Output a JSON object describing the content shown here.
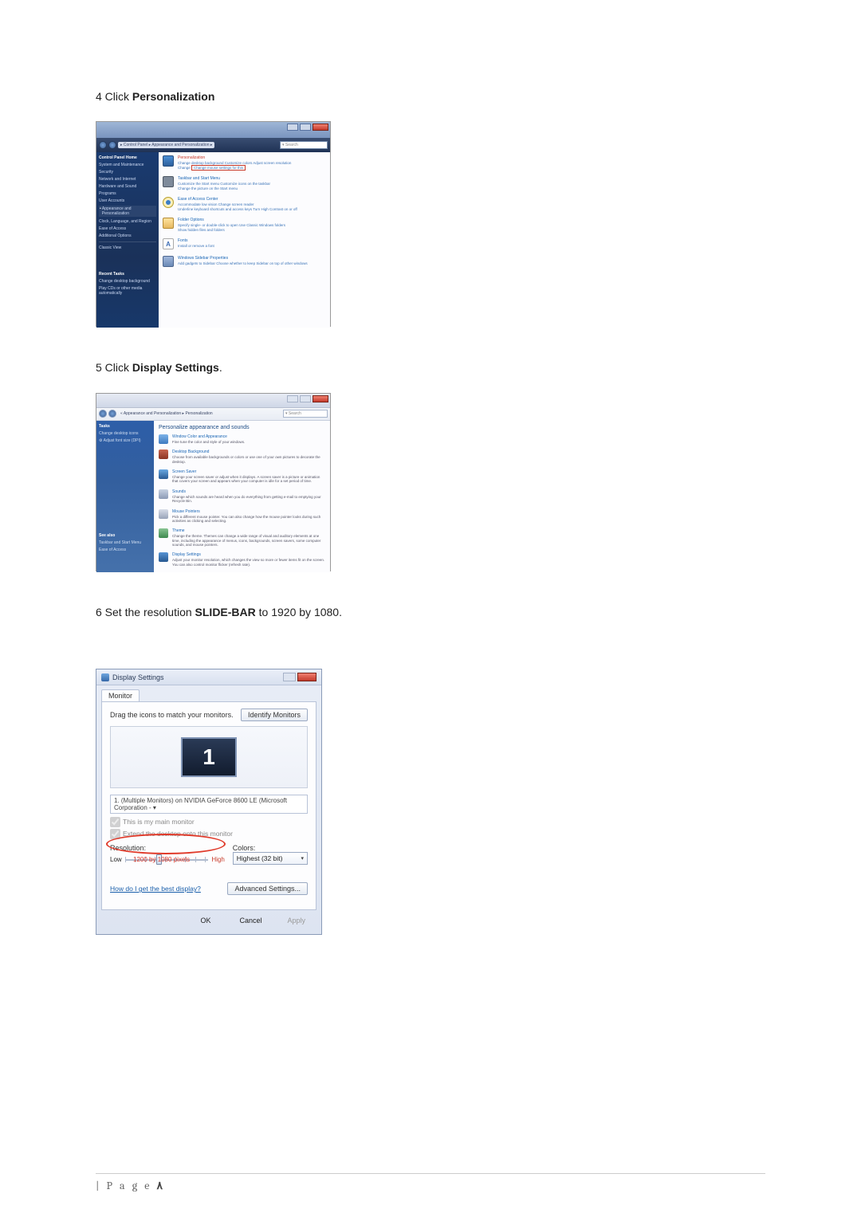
{
  "steps": {
    "s4_num": "4",
    "s4_pre": " Click ",
    "s4_bold": "Personalization",
    "s5_num": "5",
    "s5_pre": " Click ",
    "s5_bold": "Display Settings",
    "s5_post": ".",
    "s6_num": "6",
    "s6_pre": " Set the resolution ",
    "s6_bold": "SLIDE-BAR",
    "s6_post": " to 1920 by 1080."
  },
  "shot1": {
    "breadcrumb": "▸ Control Panel ▸ Appearance and Personalization ▸",
    "search": "Search",
    "sidebar": {
      "title": "Control Panel Home",
      "items": [
        "System and Maintenance",
        "Security",
        "Network and Internet",
        "Hardware and Sound",
        "Programs",
        "User Accounts"
      ],
      "sel_head": "Appearance and",
      "sel_sub": "Personalization",
      "items2": [
        "Clock, Language, and Region",
        "Ease of Access",
        "Additional Options"
      ],
      "classic": "Classic View",
      "recent": "Recent Tasks",
      "r1": "Change desktop background",
      "r2": "Play CDs or other media automatically"
    },
    "main": {
      "personalization": "Personalization",
      "pers_d": "Change desktop background    Customize colors    Adjust screen resolution",
      "pers_d2": "Change",
      "pers_box": "Change mouse settings for this",
      "taskbar": "Taskbar and Start Menu",
      "taskbar_d": "Customize the Start menu    Customize icons on the taskbar",
      "taskbar_d2": "Change the picture on the Start menu",
      "ease": "Ease of Access Center",
      "ease_d": "Accommodate low vision    Change screen reader",
      "ease_d2": "Underline keyboard shortcuts and access keys    Turn High Contrast on or off",
      "folder": "Folder Options",
      "folder_d": "Specify single- or double-click to open    Use Classic Windows folders",
      "folder_d2": "Show hidden files and folders",
      "fonts": "Fonts",
      "fonts_d": "Install or remove a font",
      "sidebar_p": "Windows Sidebar Properties",
      "sidebar_d": "Add gadgets to Sidebar    Choose whether to keep Sidebar on top of other windows"
    }
  },
  "shot2": {
    "breadcrumb": "« Appearance and Personalization ▸ Personalization",
    "search": "Search",
    "sidebar": {
      "title": "Tasks",
      "items": [
        "Change desktop icons",
        "Adjust font size (DPI)"
      ],
      "see": "See also",
      "s1": "Taskbar and Start Menu",
      "s2": "Ease of Access"
    },
    "main": {
      "heading": "Personalize appearance and sounds",
      "r1": "Window Color and Appearance",
      "r1d": "Fine tune the color and style of your windows.",
      "r2": "Desktop Background",
      "r2d": "Choose from available backgrounds or colors or use one of your own pictures to decorate the desktop.",
      "r3": "Screen Saver",
      "r3d": "Change your screen saver or adjust when it displays. A screen saver is a picture or animation that covers your screen and appears when your computer is idle for a set period of time.",
      "r4": "Sounds",
      "r4d": "Change which sounds are heard when you do everything from getting e-mail to emptying your Recycle Bin.",
      "r5": "Mouse Pointers",
      "r5d": "Pick a different mouse pointer. You can also change how the mouse pointer looks during such activities as clicking and selecting.",
      "r6": "Theme",
      "r6d": "Change the theme. Themes can change a wide range of visual and auditory elements at one time, including the appearance of menus, icons, backgrounds, screen savers, some computer sounds, and mouse pointers.",
      "r7": "Display Settings",
      "r7d": "Adjust your monitor resolution, which changes the view so more or fewer items fit on the screen. You can also control monitor flicker (refresh rate)."
    }
  },
  "shot3": {
    "title": "Display Settings",
    "tab": "Monitor",
    "drag": "Drag the icons to match your monitors.",
    "identify": "Identify Monitors",
    "mon_num": "1",
    "select": "1. (Multiple Monitors) on NVIDIA GeForce 8600 LE (Microsoft Corporation - ▾",
    "chk1": "This is my main monitor",
    "chk2": "Extend the desktop onto this monitor",
    "res_label": "Resolution:",
    "low": "Low",
    "high": "High",
    "colors_label": "Colors:",
    "colors_val": "Highest (32 bit)",
    "red_text": "1200 by 1080 pixels",
    "howlink": "How do I get the best display?",
    "adv": "Advanced Settings...",
    "ok": "OK",
    "cancel": "Cancel",
    "apply": "Apply"
  },
  "footer": {
    "page": "| P a g e "
  }
}
